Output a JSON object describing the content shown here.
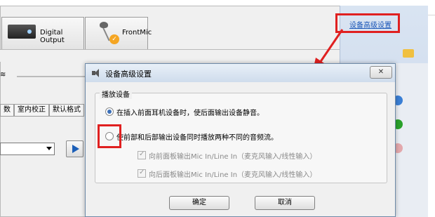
{
  "tabs": {
    "digital_output": "Digital Output",
    "front_mic": "FrontMic"
  },
  "left_panel": {
    "format_tabs": [
      "数",
      "室内校正",
      "默认格式"
    ]
  },
  "advanced_link": "设备高级设置",
  "dialog": {
    "title": "设备高级设置",
    "group_title": "播放设备",
    "option1": "在插入前面耳机设备时，使后面输出设备静音。",
    "option2": "使前部和后部输出设备同时播放两种不同的音频流。",
    "check1": "向前面板输出Mic In/Line In（麦克风输入/线性输入）",
    "check2": "向后面板输出Mic In/Line In（麦克风输入/线性输入）",
    "ok_label": "确定",
    "cancel_label": "取消",
    "close_label": "✕"
  },
  "colors": {
    "accent": "#1b57b8",
    "highlight": "#e02020"
  }
}
